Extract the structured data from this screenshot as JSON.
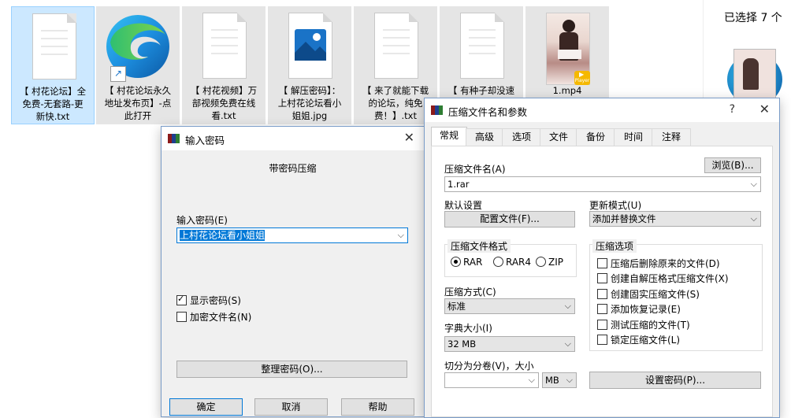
{
  "explorer": {
    "files": [
      {
        "name": "【 村花论坛】全免费-无套路-更新快.txt",
        "lines": [
          "【 村花论坛】全",
          "免费-无套路-更",
          "新快.txt"
        ],
        "type": "txt",
        "selected": true
      },
      {
        "name": "【 村花论坛永久地址发布页】-点此打开",
        "lines": [
          "【 村花论坛永久",
          "地址发布页】-点",
          "此打开"
        ],
        "type": "edge-shortcut"
      },
      {
        "name": "【 村花视频】万部视频免费在线看.txt",
        "lines": [
          "【 村花视频】万",
          "部视频免费在线",
          "看.txt"
        ],
        "type": "txt"
      },
      {
        "name": "【 解压密码】：上村花论坛看小姐姐.jpg",
        "lines": [
          "【 解压密码】：",
          "上村花论坛看小",
          "姐姐.jpg"
        ],
        "type": "jpg"
      },
      {
        "name": "【 来了就能下载的论坛，纯免费！】.txt",
        "lines": [
          "【 来了就能下载",
          "的论坛，纯免",
          "费！】.txt"
        ],
        "type": "txt"
      },
      {
        "name": "【 有种子却没速",
        "lines": [
          "【 有种子却没速"
        ],
        "type": "txt"
      },
      {
        "name": "1.mp4",
        "lines": [
          "1.mp4"
        ],
        "type": "mp4",
        "badge": "Player"
      }
    ],
    "details_header": "已选择 7 个"
  },
  "password_dialog": {
    "title": "输入密码",
    "heading": "带密码压缩",
    "field_label": "输入密码(E)",
    "password_value": "上村花论坛看小姐姐",
    "show_password_label": "显示密码(S)",
    "show_password_checked": true,
    "encrypt_names_label": "加密文件名(N)",
    "encrypt_names_checked": false,
    "organize_button": "整理密码(O)...",
    "ok_button": "确定",
    "cancel_button": "取消",
    "help_button": "帮助"
  },
  "archive_dialog": {
    "title": "压缩文件名和参数",
    "help_glyph": "?",
    "tabs": [
      "常规",
      "高级",
      "选项",
      "文件",
      "备份",
      "时间",
      "注释"
    ],
    "active_tab": 0,
    "archive_name_label": "压缩文件名(A)",
    "archive_name_value": "1.rar",
    "browse_button": "浏览(B)...",
    "default_settings_label": "默认设置",
    "profiles_button": "配置文件(F)...",
    "update_mode_label": "更新模式(U)",
    "update_mode_value": "添加并替换文件",
    "format_group_label": "压缩文件格式",
    "formats": [
      {
        "label": "RAR",
        "checked": true
      },
      {
        "label": "RAR4",
        "checked": false
      },
      {
        "label": "ZIP",
        "checked": false
      }
    ],
    "options_group_label": "压缩选项",
    "options": [
      {
        "label": "压缩后删除原来的文件(D)",
        "checked": false
      },
      {
        "label": "创建自解压格式压缩文件(X)",
        "checked": false
      },
      {
        "label": "创建固实压缩文件(S)",
        "checked": false
      },
      {
        "label": "添加恢复记录(E)",
        "checked": false
      },
      {
        "label": "测试压缩的文件(T)",
        "checked": false
      },
      {
        "label": "锁定压缩文件(L)",
        "checked": false
      }
    ],
    "method_label": "压缩方式(C)",
    "method_value": "标准",
    "dict_label": "字典大小(I)",
    "dict_value": "32 MB",
    "split_label": "切分为分卷(V)，大小",
    "split_value": "",
    "split_unit": "MB",
    "set_password_button": "设置密码(P)..."
  },
  "colors": {
    "selection": "#cce8ff",
    "tile_bg": "#e5e5e5",
    "dialog_bg": "#f0f0f0",
    "password_highlight": "#0078d7",
    "focus_border": "#0078d7"
  }
}
